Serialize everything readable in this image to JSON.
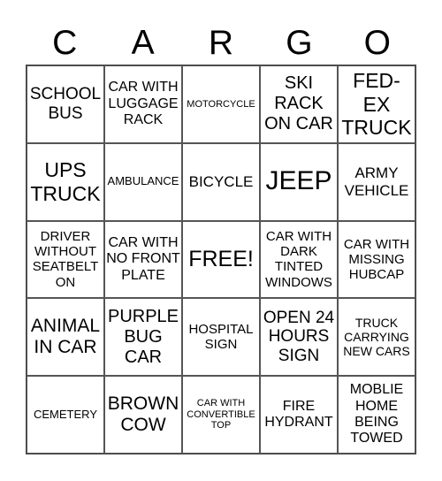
{
  "header": [
    "C",
    "A",
    "R",
    "G",
    "O"
  ],
  "cells": [
    "SCHOOL BUS",
    "CAR WITH LUGGAGE RACK",
    "MOTORCYCLE",
    "SKI RACK ON CAR",
    "FED-EX TRUCK",
    "UPS TRUCK",
    "AMBULANCE",
    "BICYCLE",
    "JEEP",
    "ARMY VEHICLE",
    "DRIVER WITHOUT SEATBELT ON",
    "CAR WITH NO FRONT PLATE",
    "FREE!",
    "CAR WITH DARK TINTED WINDOWS",
    "CAR WITH MISSING HUBCAP",
    "ANIMAL IN CAR",
    "PURPLE BUG CAR",
    "HOSPITAL SIGN",
    "OPEN 24 HOURS SIGN",
    "TRUCK CARRYING NEW CARS",
    "CEMETERY",
    "BROWN COW",
    "CAR WITH CONVERTIBLE TOP",
    "FIRE HYDRANT",
    "MOBLIE HOME BEING TOWED"
  ]
}
